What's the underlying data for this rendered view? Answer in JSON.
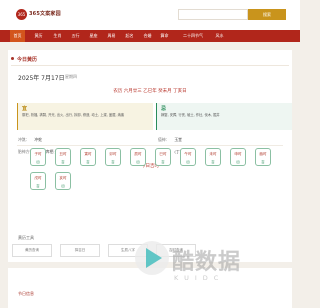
{
  "header": {
    "logo_mark": "365",
    "logo_text": "365文案家园",
    "search_placeholder": "",
    "search_button": "搜索"
  },
  "nav": {
    "items": [
      {
        "label": "首页",
        "active": true
      },
      {
        "label": "黄历"
      },
      {
        "label": "生肖"
      },
      {
        "label": "五行"
      },
      {
        "label": "星座"
      },
      {
        "label": "周易"
      },
      {
        "label": "起名"
      },
      {
        "label": "合婚"
      },
      {
        "label": "算命"
      },
      {
        "label": "二十四节气"
      },
      {
        "label": "风水"
      }
    ]
  },
  "today": {
    "section_title": "今日黄历",
    "date": "2025年 7月17日",
    "weekday": "星期四",
    "lunar": "农历 六月廿三 乙巳年 癸未月 丁亥日",
    "yi_label": "宜",
    "yi_text": "祭祀, 祈福, 求嗣, 开光, 出火, 出行, 拆卸, 修造, 动土, 上梁, 盖屋, 纳畜",
    "ji_label": "忌",
    "ji_text": "嫁娶, 安葬, 行丧, 破土, 作灶, 伐木, 掘井"
  },
  "details": {
    "rows": [
      {
        "label": "冲煞：",
        "value": "冲蛇"
      },
      {
        "label": "值神：",
        "value": "玉堂"
      },
      {
        "label": "胎神方位：",
        "value": "仓库栖 外西北"
      },
      {
        "label": "彭祖：",
        "value": "(丁亥)…"
      }
    ]
  },
  "god_hours": {
    "title": "今日吉时",
    "hours": [
      {
        "name": "子时",
        "luck": "凶"
      },
      {
        "name": "丑时",
        "luck": "吉"
      },
      {
        "name": "寅时",
        "luck": "吉"
      },
      {
        "name": "卯时",
        "luck": "吉"
      },
      {
        "name": "辰时",
        "luck": "凶"
      },
      {
        "name": "巳时",
        "luck": "吉"
      },
      {
        "name": "午时",
        "luck": "凶"
      },
      {
        "name": "未时",
        "luck": "吉"
      },
      {
        "name": "申时",
        "luck": "凶"
      },
      {
        "name": "酉时",
        "luck": "吉"
      },
      {
        "name": "戌时",
        "luck": "吉"
      },
      {
        "name": "亥时",
        "luck": "凶"
      }
    ]
  },
  "tools": {
    "title": "黄历工具",
    "buttons": [
      "黄历查询",
      "择吉日",
      "生辰八字",
      "吉时查询"
    ]
  },
  "bottom": {
    "title": "节日信息"
  },
  "watermark": {
    "big": "酷数据",
    "small": "KUIDC"
  }
}
